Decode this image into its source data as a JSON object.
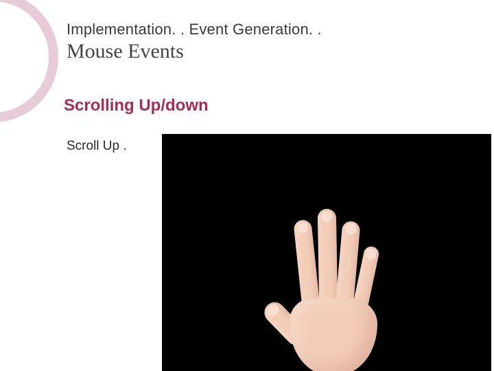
{
  "breadcrumb": "Implementation. . Event Generation. .",
  "title": "Mouse Events",
  "subtitle": "Scrolling Up/down",
  "body_text": "Scroll Up .",
  "media": {
    "description": "open-hand-gesture",
    "background": "#000000",
    "skin": "#f3cdb8"
  },
  "accent_color": "#aa2a56",
  "ring_color": "#e7cbd6"
}
